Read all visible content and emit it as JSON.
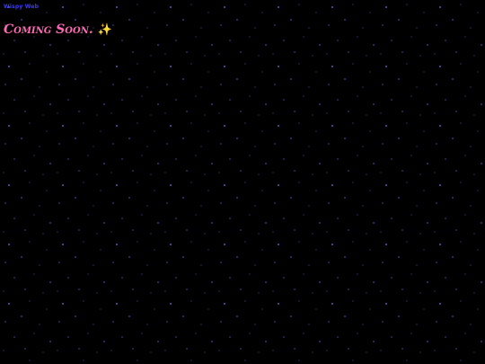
{
  "nav": {
    "home_link_label": "Wispy Web"
  },
  "main": {
    "headline": "Coming Soon.",
    "sparkle_icon": "✨"
  },
  "colors": {
    "background": "#000000",
    "link": "#3a3aff",
    "headline": "#ff69b4",
    "star": "#6f7cff"
  }
}
